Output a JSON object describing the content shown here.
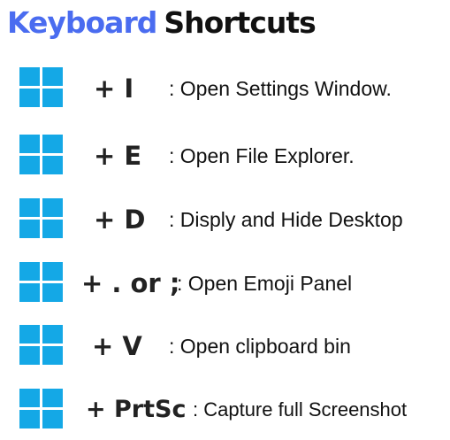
{
  "title": {
    "part1": "Keyboard",
    "part2": "Shortcuts"
  },
  "colors": {
    "title_accent": "#4a6cf0",
    "windows_logo": "#14a8e6",
    "text": "#111111"
  },
  "shortcuts": [
    {
      "icon": "windows-logo-icon",
      "key": "+ I",
      "description": ": Open Settings Window."
    },
    {
      "icon": "windows-logo-icon",
      "key": "+ E",
      "description": ": Open File Explorer."
    },
    {
      "icon": "windows-logo-icon",
      "key": "+ D",
      "description": ": Disply and Hide Desktop"
    },
    {
      "icon": "windows-logo-icon",
      "key": "+ . or ;",
      "description": ": Open Emoji Panel"
    },
    {
      "icon": "windows-logo-icon",
      "key": "+ V",
      "description": ": Open clipboard bin"
    },
    {
      "icon": "windows-logo-icon",
      "key": "+ PrtSc",
      "description": ": Capture full Screenshot"
    }
  ]
}
